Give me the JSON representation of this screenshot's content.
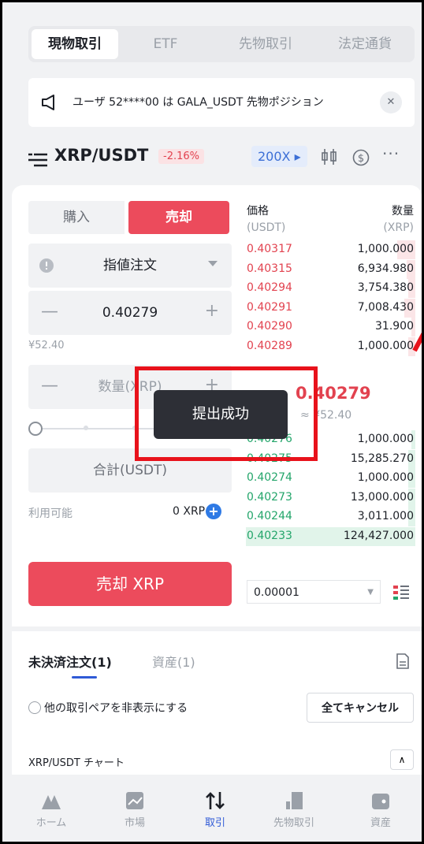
{
  "tabs": [
    "現物取引",
    "ETF",
    "先物取引",
    "法定通貨"
  ],
  "notice": {
    "text": "ユーザ 52****00 は GALA_USDT 先物ポジション",
    "close_glyph": "✕"
  },
  "pair": {
    "name": "XRP/USDT",
    "change": "-2.16%",
    "leverage": "200X ▸",
    "more_glyph": "···"
  },
  "order": {
    "buy_label": "購入",
    "sell_label": "売却",
    "type_label": "指値注文",
    "price_value": "0.40279",
    "minus_glyph": "—",
    "plus_glyph": "+",
    "cny": "¥52.40",
    "amount_placeholder": "数量(XRP)",
    "total_placeholder": "合計(USDT)",
    "available_label": "利用可能",
    "available_value": "0 XRP",
    "submit_label": "売却 XRP"
  },
  "orderbook": {
    "price_header": "価格",
    "price_unit": "(USDT)",
    "qty_header": "数量",
    "qty_unit": "(XRP)",
    "asks": [
      {
        "price": "0.40317",
        "qty": "1,000.000",
        "depth": 0.1
      },
      {
        "price": "0.40315",
        "qty": "6,934.980",
        "depth": 0.05
      },
      {
        "price": "0.40294",
        "qty": "3,754.380",
        "depth": 0.04
      },
      {
        "price": "0.40291",
        "qty": "7,008.430",
        "depth": 0.06
      },
      {
        "price": "0.40290",
        "qty": "31.900",
        "depth": 0.02
      },
      {
        "price": "0.40289",
        "qty": "1,000.000",
        "depth": 0.04
      }
    ],
    "mid_price": "0.40279",
    "mid_cny": "≈ ¥52.40",
    "bids": [
      {
        "price": "0.40276",
        "qty": "1,000.000",
        "depth": 0.02
      },
      {
        "price": "0.40275",
        "qty": "15,285.270",
        "depth": 0.04
      },
      {
        "price": "0.40274",
        "qty": "1,000.000",
        "depth": 0.04
      },
      {
        "price": "0.40273",
        "qty": "13,000.000",
        "depth": 0.04
      },
      {
        "price": "0.40244",
        "qty": "3,011.000",
        "depth": 0.04
      },
      {
        "price": "0.40233",
        "qty": "124,427.000",
        "depth": 0.95
      }
    ],
    "tick_size": "0.00001"
  },
  "toast": "提出成功",
  "orders": {
    "open_label": "未決済注文(1)",
    "assets_label": "資産(1)",
    "hide_label": "他の取引ペアを非表示にする",
    "cancel_all": "全てキャンセル",
    "chart_label": "XRP/USDT チャート"
  },
  "nav": [
    "ホーム",
    "市場",
    "取引",
    "先物取引",
    "資産"
  ],
  "colors": {
    "sell": "#ec4b5c",
    "buy": "#23a56a",
    "accent": "#2f5ad6",
    "highlight": "#e8121b"
  }
}
